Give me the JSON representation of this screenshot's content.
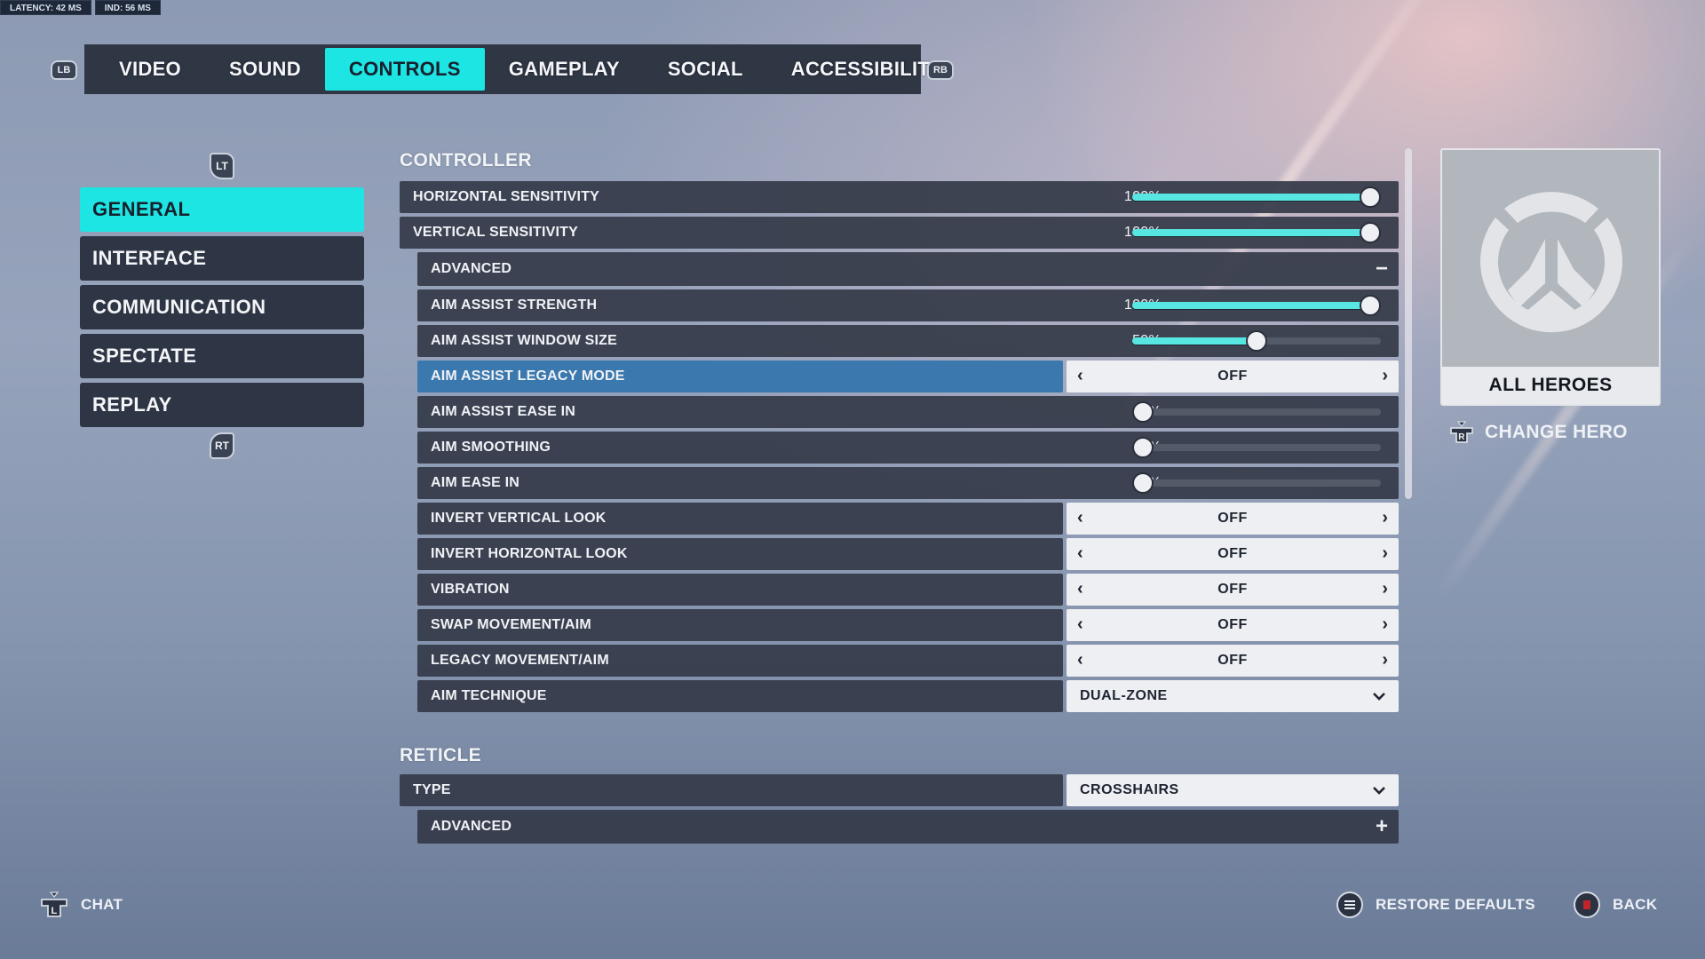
{
  "stats": {
    "latency": "LATENCY:  42 MS",
    "ind": "IND:  56 MS"
  },
  "top_tabs": {
    "left_bumper": "LB",
    "right_bumper": "RB",
    "items": [
      {
        "label": "VIDEO",
        "active": false
      },
      {
        "label": "SOUND",
        "active": false
      },
      {
        "label": "CONTROLS",
        "active": true
      },
      {
        "label": "GAMEPLAY",
        "active": false
      },
      {
        "label": "SOCIAL",
        "active": false
      },
      {
        "label": "ACCESSIBILITY",
        "active": false
      }
    ]
  },
  "sidebar": {
    "top_trigger": "LT",
    "bottom_trigger": "RT",
    "items": [
      {
        "label": "GENERAL",
        "active": true
      },
      {
        "label": "INTERFACE",
        "active": false
      },
      {
        "label": "COMMUNICATION",
        "active": false
      },
      {
        "label": "SPECTATE",
        "active": false
      },
      {
        "label": "REPLAY",
        "active": false
      }
    ]
  },
  "controller": {
    "heading": "CONTROLLER",
    "horizontal_sensitivity": {
      "label": "HORIZONTAL SENSITIVITY",
      "value_text": "100%",
      "value": 100
    },
    "vertical_sensitivity": {
      "label": "VERTICAL SENSITIVITY",
      "value_text": "100%",
      "value": 100
    },
    "advanced": {
      "label": "ADVANCED",
      "state_icon": "minus-icon"
    },
    "aim_assist_strength": {
      "label": "AIM ASSIST STRENGTH",
      "value_text": "100%",
      "value": 100
    },
    "aim_assist_window_size": {
      "label": "AIM ASSIST WINDOW SIZE",
      "value_text": "50%",
      "value": 50
    },
    "aim_assist_legacy_mode": {
      "label": "AIM ASSIST LEGACY MODE",
      "value": "OFF"
    },
    "aim_assist_ease_in": {
      "label": "AIM ASSIST EASE IN",
      "value_text": "0%",
      "value": 0
    },
    "aim_smoothing": {
      "label": "AIM SMOOTHING",
      "value_text": "0%",
      "value": 0
    },
    "aim_ease_in": {
      "label": "AIM EASE IN",
      "value_text": "0%",
      "value": 0
    },
    "invert_vertical_look": {
      "label": "INVERT VERTICAL LOOK",
      "value": "OFF"
    },
    "invert_horizontal_look": {
      "label": "INVERT HORIZONTAL LOOK",
      "value": "OFF"
    },
    "vibration": {
      "label": "VIBRATION",
      "value": "OFF"
    },
    "swap_movement_aim": {
      "label": "SWAP MOVEMENT/AIM",
      "value": "OFF"
    },
    "legacy_movement_aim": {
      "label": "LEGACY MOVEMENT/AIM",
      "value": "OFF"
    },
    "aim_technique": {
      "label": "AIM TECHNIQUE",
      "value": "DUAL-ZONE"
    }
  },
  "reticle": {
    "heading": "RETICLE",
    "type": {
      "label": "TYPE",
      "value": "CROSSHAIRS"
    },
    "advanced": {
      "label": "ADVANCED",
      "state_icon": "plus-icon"
    }
  },
  "hero_panel": {
    "hero_name": "ALL HEROES",
    "change_hero_label": "CHANGE HERO",
    "change_hero_key": "R"
  },
  "footer": {
    "chat_label": "CHAT",
    "chat_key": "L",
    "restore_defaults_label": "RESTORE DEFAULTS",
    "back_label": "BACK"
  },
  "colors": {
    "accent_cyan": "#1de5e3",
    "slider_fill": "#58e6e2",
    "selected_row": "#3b78ae",
    "panel_dark": "#2f3644",
    "back_button_red": "#c0252c"
  }
}
